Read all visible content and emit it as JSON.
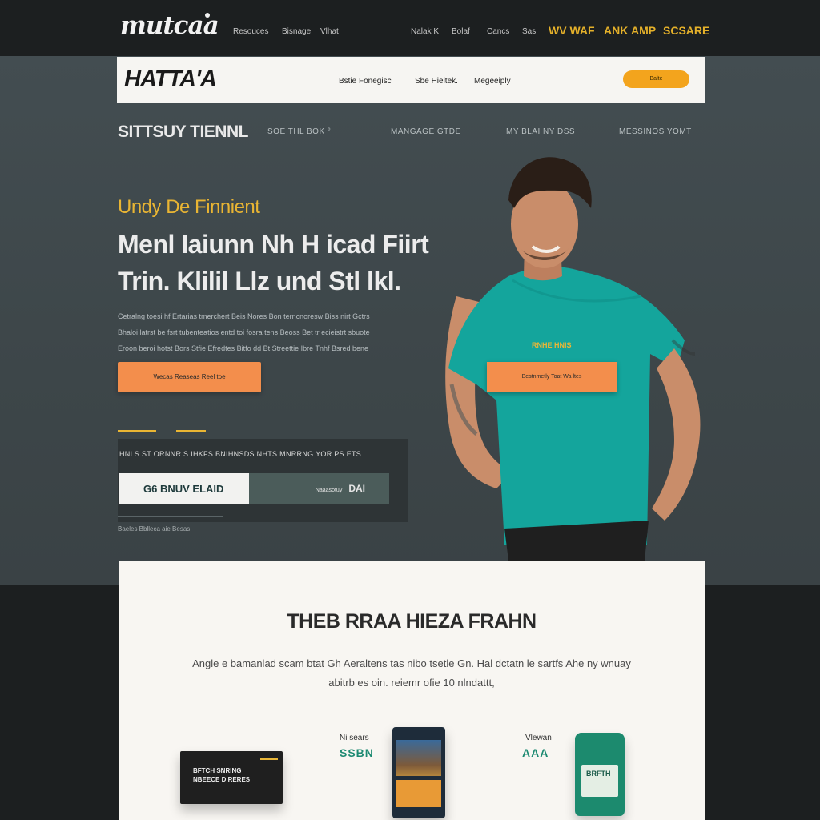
{
  "topbar": {
    "logo": "mutcaa",
    "nav_left": [
      "Resouces",
      "Bisnage",
      "Vlhat"
    ],
    "nav_right": [
      "Nalak K",
      "Bolaf",
      "Cancs",
      "Sas"
    ],
    "nav_accent": [
      "WV WAF",
      "ANK",
      "AMP",
      "SCSARE"
    ]
  },
  "navcard": {
    "brand": "HATTA'A",
    "items": [
      "Bstie Fonegisc",
      "Sbe Hieitek.",
      "Megeeiply"
    ],
    "cta": "Balte"
  },
  "subnav": {
    "title": "SITTSUY TIENNL",
    "items": [
      "SOE THL BOK °",
      "MANGAGE GTDE",
      "MY BLAI NY DSS",
      "MESSINOS YOMT"
    ]
  },
  "hero": {
    "eyebrow": "Undy De Finnient",
    "headline_1": "Menl Iaiunn Nh H icad Fiirt",
    "headline_2": "Trin. Klilil Llz und Stl lkl.",
    "body_1": "Cetralng toesi hf Ertarias tmerchert Beis Nores Bon terncnoresw Biss nirt Gctrs",
    "body_2": "Bhaloi latrst be fsrt tubenteatios entd toi fosra tens Beoss Bet tr ecieistrt sbuote",
    "body_3": "Eroon beroi hotst Bors Stfie Efredtes Bitfo dd Bt Streettie Ibre Tnhf Bsred bene",
    "cta": "Wecas Reaseas Reel toe",
    "subscribe_title": "HNLS ST ORNNR S IHKFS BNIHNSDS NHTS MNRRNG YOR PS ETS",
    "subscribe_input": "G6 BNUV ELAID",
    "subscribe_button": "Naaasotuy",
    "subscribe_button_tag": "DAI",
    "footnote": "Baeles Bblleca aie Besas"
  },
  "runner": {
    "shirt_text": "RNHE HNIS",
    "button": "Bestnmetly Toat Wa ltes"
  },
  "card": {
    "title": "THEB RRAA HIEZA FRAHN",
    "line_1": "Angle e bamanlad scam btat Gh Aeraltens tas nibo tsetle Gn. Hal dctatn le sartfs Ahe ny wnuay",
    "line_2": "abitrb es oin. reiemr ofie 10 nlndattt,",
    "products": [
      {
        "label": "",
        "price": "",
        "box_line_1": "BFTCH SNRING",
        "box_line_2": "NBEECE D RERES"
      },
      {
        "label": "Ni sears",
        "price": "SSBN"
      },
      {
        "label": "Vlewan",
        "price": "AAA",
        "can_label": "BRFTH"
      }
    ]
  },
  "colors": {
    "accent_yellow": "#e9b533",
    "accent_orange": "#f38e4c",
    "teal": "#1c8a6e",
    "hero_bg": "#434d51"
  }
}
